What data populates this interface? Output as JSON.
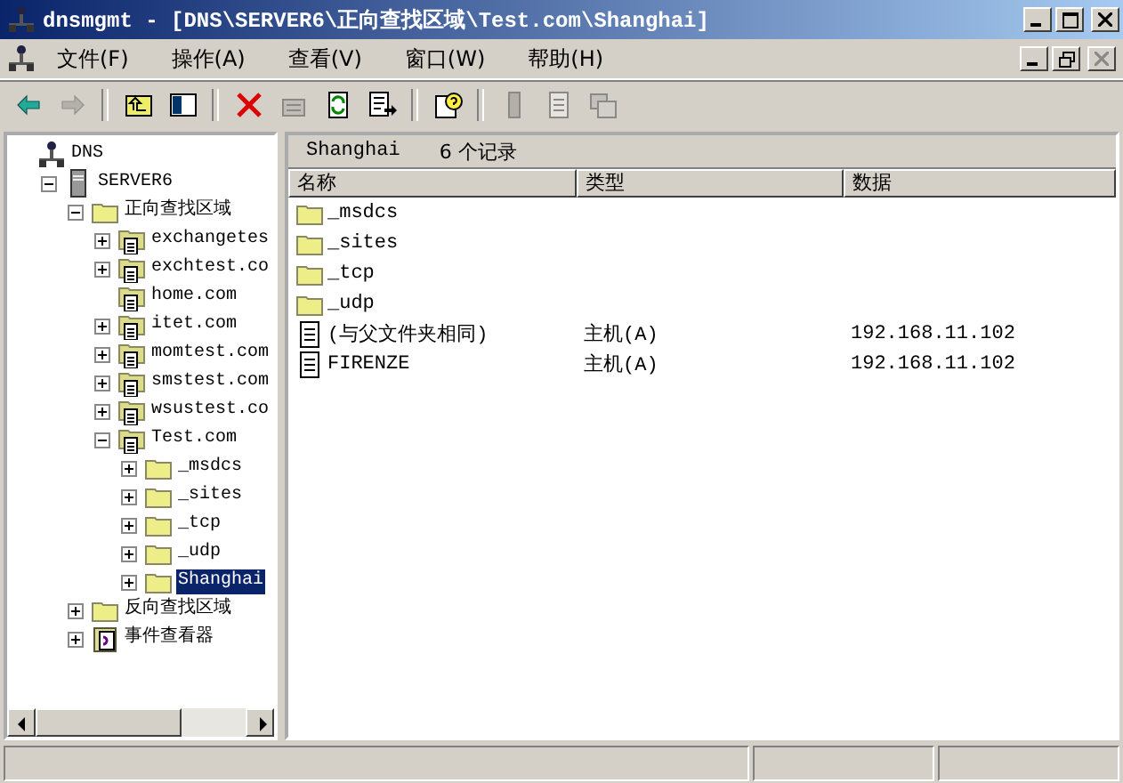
{
  "window": {
    "title": "dnsmgmt - [DNS\\SERVER6\\正向查找区域\\Test.com\\Shanghai]"
  },
  "menu": [
    "文件(F)",
    "操作(A)",
    "查看(V)",
    "窗口(W)",
    "帮助(H)"
  ],
  "toolbar": [
    [
      {
        "kind": "back",
        "disabled": false
      },
      {
        "kind": "forward",
        "disabled": true
      }
    ],
    [
      {
        "kind": "up",
        "disabled": false
      },
      {
        "kind": "tree",
        "disabled": false
      }
    ],
    [
      {
        "kind": "delete",
        "disabled": false
      },
      {
        "kind": "properties",
        "disabled": true
      },
      {
        "kind": "refresh",
        "disabled": false
      },
      {
        "kind": "export",
        "disabled": false
      }
    ],
    [
      {
        "kind": "help",
        "disabled": false
      }
    ],
    [
      {
        "kind": "server",
        "disabled": true
      },
      {
        "kind": "record",
        "disabled": true
      },
      {
        "kind": "windows",
        "disabled": true
      }
    ]
  ],
  "tree": [
    {
      "label": "DNS",
      "kind": "network",
      "selected": false,
      "children": [
        {
          "label": "SERVER6",
          "kind": "server",
          "expanded": true,
          "selected": false,
          "children": [
            {
              "label": "正向查找区域",
              "kind": "folder",
              "expanded": true,
              "selected": false,
              "children": [
                {
                  "label": "exchangetes",
                  "kind": "zone",
                  "expanded": false,
                  "selected": false
                },
                {
                  "label": "exchtest.co",
                  "kind": "zone",
                  "expanded": false,
                  "selected": false
                },
                {
                  "label": "home.com",
                  "kind": "zone",
                  "selected": false
                },
                {
                  "label": "itet.com",
                  "kind": "zone",
                  "expanded": false,
                  "selected": false
                },
                {
                  "label": "momtest.com",
                  "kind": "zone",
                  "expanded": false,
                  "selected": false
                },
                {
                  "label": "smstest.com",
                  "kind": "zone",
                  "expanded": false,
                  "selected": false
                },
                {
                  "label": "wsustest.co",
                  "kind": "zone",
                  "expanded": false,
                  "selected": false
                },
                {
                  "label": "Test.com",
                  "kind": "zone",
                  "expanded": true,
                  "selected": false,
                  "children": [
                    {
                      "label": "_msdcs",
                      "kind": "folder",
                      "expanded": false,
                      "selected": false
                    },
                    {
                      "label": "_sites",
                      "kind": "folder",
                      "expanded": false,
                      "selected": false
                    },
                    {
                      "label": "_tcp",
                      "kind": "folder",
                      "expanded": false,
                      "selected": false
                    },
                    {
                      "label": "_udp",
                      "kind": "folder",
                      "expanded": false,
                      "selected": false
                    },
                    {
                      "label": "Shanghai",
                      "kind": "folder",
                      "expanded": false,
                      "selected": true
                    }
                  ]
                }
              ]
            },
            {
              "label": "反向查找区域",
              "kind": "folder",
              "expanded": false,
              "selected": false
            },
            {
              "label": "事件查看器",
              "kind": "log",
              "expanded": false,
              "selected": false
            }
          ]
        }
      ]
    }
  ],
  "panel": {
    "title": "Shanghai",
    "count": "6 个记录"
  },
  "columns": [
    "名称",
    "类型",
    "数据"
  ],
  "rows": [
    {
      "kind": "folder",
      "name": "_msdcs"
    },
    {
      "kind": "folder",
      "name": "_sites"
    },
    {
      "kind": "folder",
      "name": "_tcp"
    },
    {
      "kind": "folder",
      "name": "_udp"
    },
    {
      "kind": "record",
      "name": "(与父文件夹相同)",
      "type": "主机(A)",
      "data": "192.168.11.102"
    },
    {
      "kind": "record",
      "name": "FIRENZE",
      "type": "主机(A)",
      "data": "192.168.11.102"
    }
  ]
}
